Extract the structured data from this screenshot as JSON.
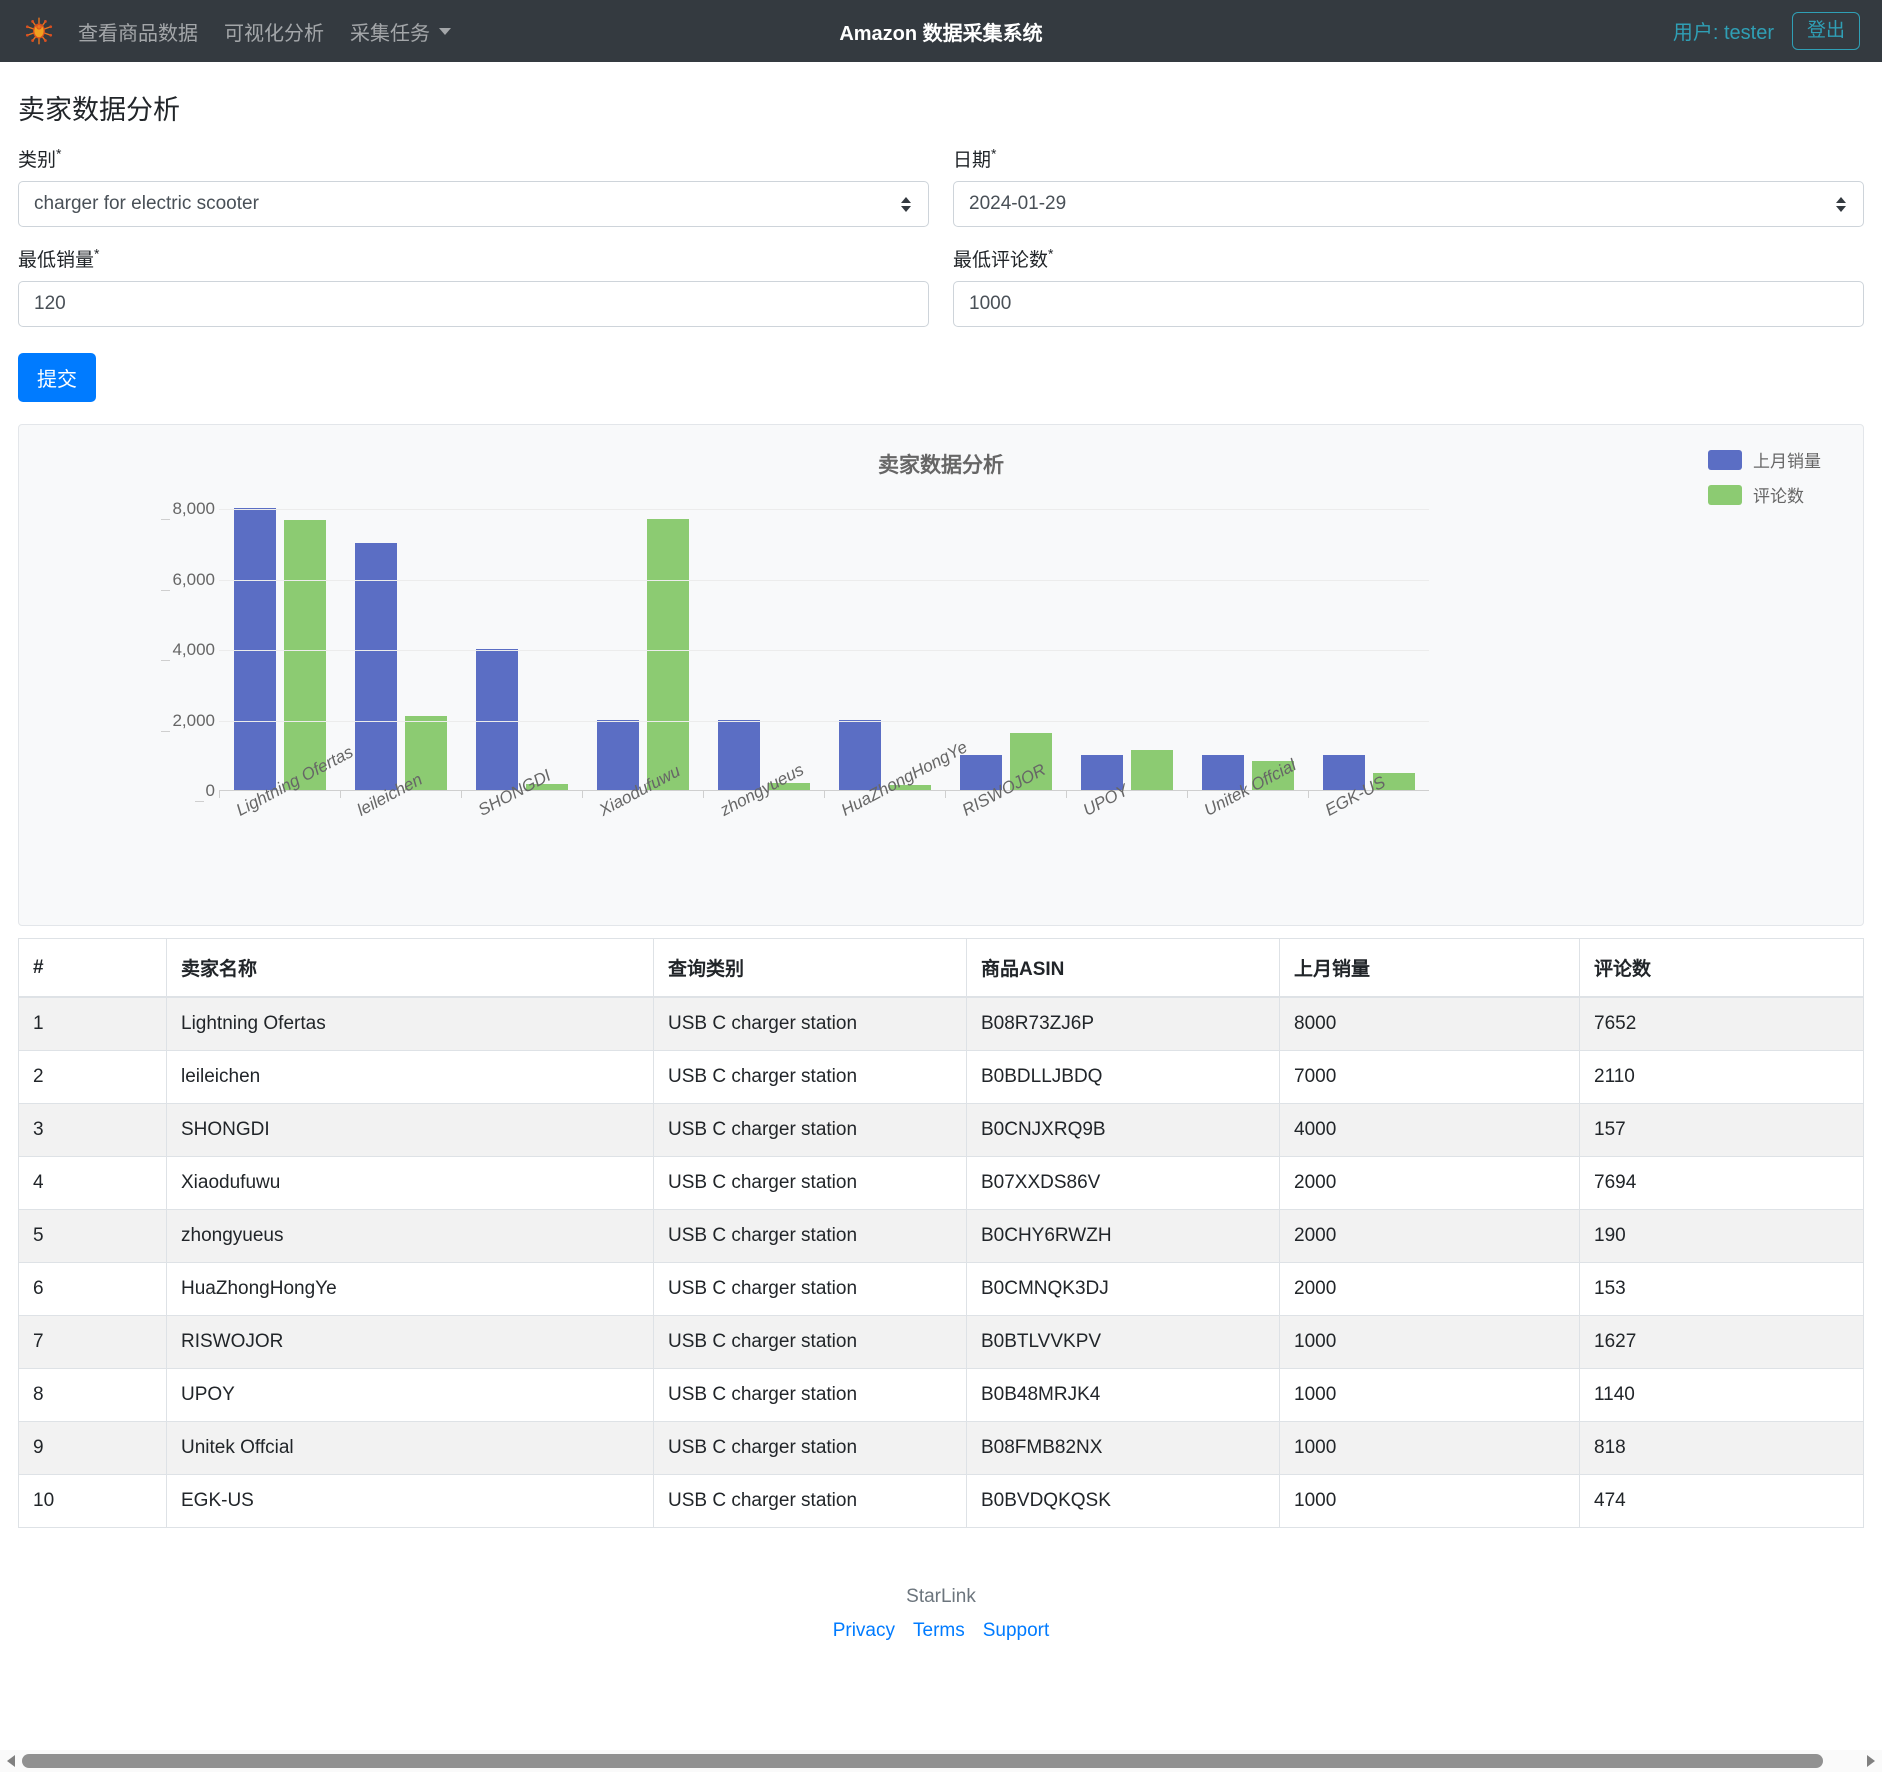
{
  "navbar": {
    "logo_icon": "spider-logo-icon",
    "links": [
      {
        "label": "查看商品数据",
        "icon": null
      },
      {
        "label": "可视化分析",
        "icon": null
      },
      {
        "label": "采集任务",
        "icon": "chevron-down-icon"
      }
    ],
    "title": "Amazon 数据采集系统",
    "user_label": "用户: tester",
    "logout_label": "登出",
    "accent_color": "#2f9fb5",
    "bg_color": "#343a40"
  },
  "page": {
    "title": "卖家数据分析"
  },
  "form": {
    "category": {
      "label": "类别",
      "required_mark": "*",
      "value": "charger for electric scooter"
    },
    "date": {
      "label": "日期",
      "required_mark": "*",
      "value": "2024-01-29"
    },
    "min_sales": {
      "label": "最低销量",
      "required_mark": "*",
      "value": "120"
    },
    "min_reviews": {
      "label": "最低评论数",
      "required_mark": "*",
      "value": "1000"
    },
    "submit_label": "提交"
  },
  "chart_data": {
    "type": "bar",
    "title": "卖家数据分析",
    "xlabel": "",
    "ylabel": "",
    "ylim": [
      0,
      8000
    ],
    "yticks": [
      0,
      2000,
      4000,
      6000,
      8000
    ],
    "ytick_labels": [
      "0",
      "2,000",
      "4,000",
      "6,000",
      "8,000"
    ],
    "grid": true,
    "legend_position": "top-right",
    "categories": [
      "Lightning Ofertas",
      "leileichen",
      "SHONGDI",
      "Xiaodufuwu",
      "zhongyueus",
      "HuaZhongHongYe",
      "RISWOJOR",
      "UPOY",
      "Unitek Offcial",
      "EGK-US"
    ],
    "series": [
      {
        "name": "上月销量",
        "color": "#5b6ec4",
        "values": [
          8000,
          7000,
          4000,
          2000,
          2000,
          2000,
          1000,
          1000,
          1000,
          1000
        ]
      },
      {
        "name": "评论数",
        "color": "#8ccb72",
        "values": [
          7652,
          2110,
          157,
          7694,
          190,
          153,
          1627,
          1140,
          818,
          474
        ]
      }
    ]
  },
  "table": {
    "columns": [
      "#",
      "卖家名称",
      "查询类别",
      "商品ASIN",
      "上月销量",
      "评论数"
    ],
    "rows": [
      {
        "idx": "1",
        "seller": "Lightning Ofertas",
        "category": "USB C charger station",
        "asin": "B08R73ZJ6P",
        "sales": "8000",
        "reviews": "7652"
      },
      {
        "idx": "2",
        "seller": "leileichen",
        "category": "USB C charger station",
        "asin": "B0BDLLJBDQ",
        "sales": "7000",
        "reviews": "2110"
      },
      {
        "idx": "3",
        "seller": "SHONGDI",
        "category": "USB C charger station",
        "asin": "B0CNJXRQ9B",
        "sales": "4000",
        "reviews": "157"
      },
      {
        "idx": "4",
        "seller": "Xiaodufuwu",
        "category": "USB C charger station",
        "asin": "B07XXDS86V",
        "sales": "2000",
        "reviews": "7694"
      },
      {
        "idx": "5",
        "seller": "zhongyueus",
        "category": "USB C charger station",
        "asin": "B0CHY6RWZH",
        "sales": "2000",
        "reviews": "190"
      },
      {
        "idx": "6",
        "seller": "HuaZhongHongYe",
        "category": "USB C charger station",
        "asin": "B0CMNQK3DJ",
        "sales": "2000",
        "reviews": "153"
      },
      {
        "idx": "7",
        "seller": "RISWOJOR",
        "category": "USB C charger station",
        "asin": "B0BTLVVKPV",
        "sales": "1000",
        "reviews": "1627"
      },
      {
        "idx": "8",
        "seller": "UPOY",
        "category": "USB C charger station",
        "asin": "B0B48MRJK4",
        "sales": "1000",
        "reviews": "1140"
      },
      {
        "idx": "9",
        "seller": "Unitek Offcial",
        "category": "USB C charger station",
        "asin": "B08FMB82NX",
        "sales": "1000",
        "reviews": "818"
      },
      {
        "idx": "10",
        "seller": "EGK-US",
        "category": "USB C charger station",
        "asin": "B0BVDQKQSK",
        "sales": "1000",
        "reviews": "474"
      }
    ]
  },
  "footer": {
    "brand": "StarLink",
    "links": [
      "Privacy",
      "Terms",
      "Support"
    ]
  }
}
